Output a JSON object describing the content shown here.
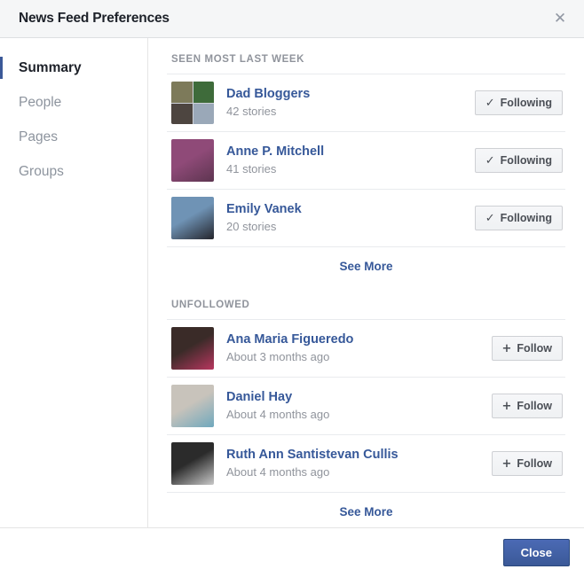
{
  "header": {
    "title": "News Feed Preferences",
    "close_icon": "close-icon"
  },
  "sidebar": {
    "items": [
      {
        "label": "Summary",
        "active": true
      },
      {
        "label": "People",
        "active": false
      },
      {
        "label": "Pages",
        "active": false
      },
      {
        "label": "Groups",
        "active": false
      }
    ]
  },
  "sections": [
    {
      "label": "SEEN MOST LAST WEEK",
      "rows": [
        {
          "name": "Dad Bloggers",
          "meta": "42 stories",
          "button": {
            "label": "Following",
            "icon": "check-icon",
            "glyph": "✓"
          },
          "avatar": {
            "type": "photo-grid",
            "colors": [
              "#7d7a5a",
              "#3e6b3a",
              "#4d4540",
              "#9aa8b8"
            ]
          }
        },
        {
          "name": "Anne P. Mitchell",
          "meta": "41 stories",
          "button": {
            "label": "Following",
            "icon": "check-icon",
            "glyph": "✓"
          },
          "avatar": {
            "type": "photo",
            "colors": [
              "#8f4a78",
              "#5d3550"
            ]
          }
        },
        {
          "name": "Emily Vanek",
          "meta": "20 stories",
          "button": {
            "label": "Following",
            "icon": "check-icon",
            "glyph": "✓"
          },
          "avatar": {
            "type": "photo",
            "colors": [
              "#6f93b5",
              "#24252c"
            ]
          }
        }
      ],
      "see_more": "See More"
    },
    {
      "label": "UNFOLLOWED",
      "rows": [
        {
          "name": "Ana Maria Figueredo",
          "meta": "About 3 months ago",
          "button": {
            "label": "Follow",
            "icon": "plus-icon",
            "glyph": "+"
          },
          "avatar": {
            "type": "photo",
            "colors": [
              "#3a2b28",
              "#b8365f"
            ]
          }
        },
        {
          "name": "Daniel Hay",
          "meta": "About 4 months ago",
          "button": {
            "label": "Follow",
            "icon": "plus-icon",
            "glyph": "+"
          },
          "avatar": {
            "type": "photo",
            "colors": [
              "#c8c3bb",
              "#6fa8bd"
            ]
          }
        },
        {
          "name": "Ruth Ann Santistevan Cullis",
          "meta": "About 4 months ago",
          "button": {
            "label": "Follow",
            "icon": "plus-icon",
            "glyph": "+"
          },
          "avatar": {
            "type": "photo",
            "colors": [
              "#2b2b2b",
              "#c9c9c9"
            ]
          }
        }
      ],
      "see_more": "See More"
    }
  ],
  "footer": {
    "close_label": "Close"
  },
  "colors": {
    "brand_blue": "#3b5998",
    "link_blue": "#365899",
    "muted_gray": "#90949c",
    "header_bg": "#f5f6f7"
  }
}
